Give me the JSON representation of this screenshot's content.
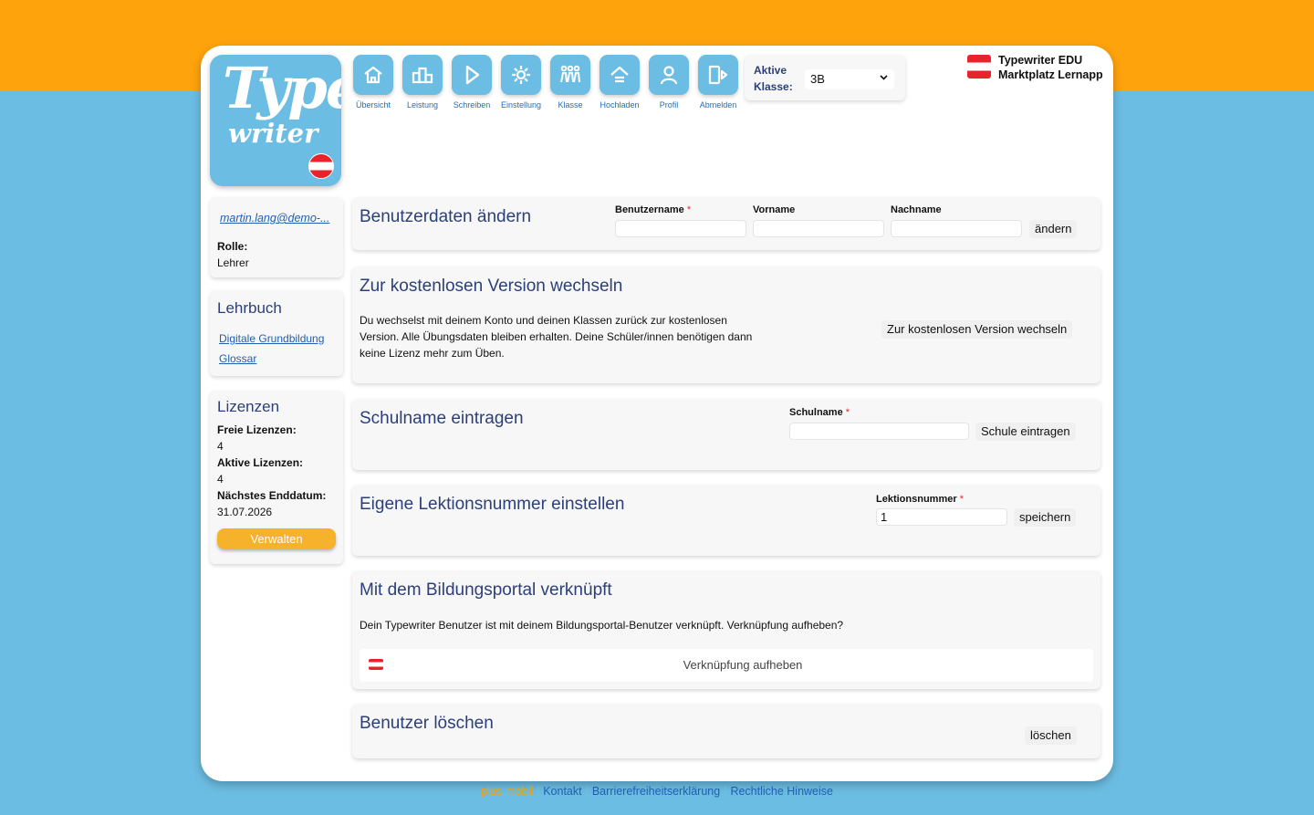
{
  "brand": {
    "logo_line1": "Type",
    "logo_line2": "writer",
    "title_line1": "Typewriter EDU",
    "title_line2": "Marktplatz Lernapp"
  },
  "nav": [
    {
      "label": "Übersicht",
      "icon": "home-icon"
    },
    {
      "label": "Leistung",
      "icon": "podium-icon"
    },
    {
      "label": "Schreiben",
      "icon": "play-icon"
    },
    {
      "label": "Einstellung",
      "icon": "gear-icon"
    },
    {
      "label": "Klasse",
      "icon": "group-icon"
    },
    {
      "label": "Hochladen",
      "icon": "upload-icon"
    },
    {
      "label": "Profil",
      "icon": "user-icon"
    },
    {
      "label": "Abmelden",
      "icon": "logout-icon"
    }
  ],
  "klasse": {
    "label_line1": "Aktive",
    "label_line2": "Klasse:",
    "selected": "3B"
  },
  "sidebar": {
    "email": "martin.lang@demo-...",
    "role_label": "Rolle:",
    "role_value": "Lehrer",
    "lehrbuch_title": "Lehrbuch",
    "lehrbuch_links": [
      "Digitale Grundbildung",
      "Glossar"
    ],
    "lizenzen_title": "Lizenzen",
    "freie_label": "Freie Lizenzen:",
    "freie_value": "4",
    "aktive_label": "Aktive Lizenzen:",
    "aktive_value": "4",
    "end_label": "Nächstes Enddatum:",
    "end_value": "31.07.2026",
    "verwalten": "Verwalten"
  },
  "cards": {
    "userdata": {
      "title": "Benutzerdaten ändern",
      "username_label": "Benutzername",
      "vorname_label": "Vorname",
      "nachname_label": "Nachname",
      "username_value": "",
      "vorname_value": "",
      "nachname_value": "",
      "button": "ändern"
    },
    "free": {
      "title": "Zur kostenlosen Version wechseln",
      "text": "Du wechselst mit deinem Konto und deinen Klassen zurück zur kostenlosen Version. Alle Übungsdaten bleiben erhalten. Deine Schüler/innen benötigen dann keine Lizenz mehr zum Üben.",
      "button": "Zur kostenlosen Version wechseln"
    },
    "school": {
      "title": "Schulname eintragen",
      "label": "Schulname",
      "value": "",
      "button": "Schule eintragen"
    },
    "lesson": {
      "title": "Eigene Lektionsnummer einstellen",
      "label": "Lektionsnummer",
      "value": "1",
      "button": "speichern"
    },
    "portal": {
      "title": "Mit dem Bildungsportal verknüpft",
      "text": "Dein Typewriter Benutzer ist mit deinem Bildungsportal-Benutzer verknüpft. Verknüpfung aufheben?",
      "button": "Verknüpfung aufheben"
    },
    "delete": {
      "title": "Benutzer löschen",
      "button": "löschen"
    }
  },
  "required_marker": "*",
  "footer": {
    "made": "plus-mobil",
    "links": [
      "Kontakt",
      "Barrierefreiheitserklärung",
      "Rechtliche Hinweise"
    ]
  },
  "colors": {
    "orange": "#ffa30d",
    "blue": "#6cbde3",
    "title_navy": "#2b3f7a",
    "link_blue": "#1f5fb0"
  }
}
